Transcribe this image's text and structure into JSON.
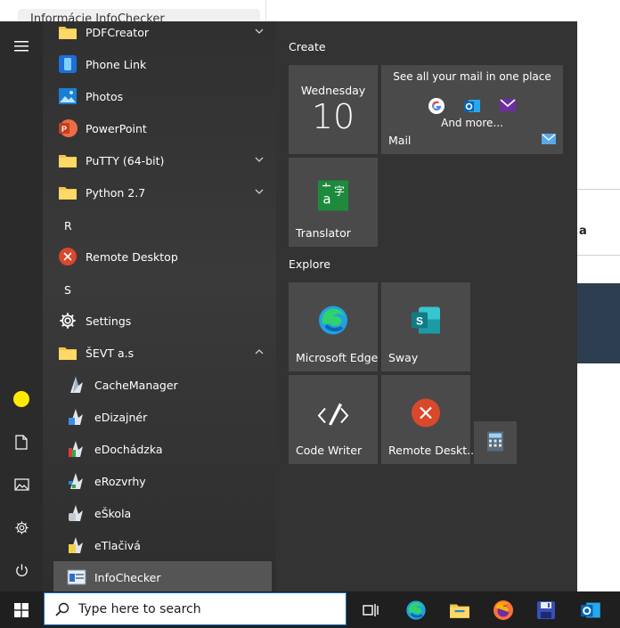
{
  "background": {
    "top_text": "Informácie InfoChecker",
    "letter_fragment": "a"
  },
  "app_list": {
    "items": [
      {
        "label": "PDFCreator",
        "icon": "folder-icon",
        "expandable": true
      },
      {
        "label": "Phone Link",
        "icon": "phone-link-icon"
      },
      {
        "label": "Photos",
        "icon": "photos-icon"
      },
      {
        "label": "PowerPoint",
        "icon": "powerpoint-icon"
      },
      {
        "label": "PuTTY (64-bit)",
        "icon": "folder-icon",
        "expandable": true
      },
      {
        "label": "Python 2.7",
        "icon": "folder-icon",
        "expandable": true
      },
      {
        "header": "R"
      },
      {
        "label": "Remote Desktop",
        "icon": "remote-desktop-icon"
      },
      {
        "header": "S"
      },
      {
        "label": "Settings",
        "icon": "gear-icon"
      },
      {
        "label": "ŠEVT a.s",
        "icon": "folder-icon",
        "expanded": true
      },
      {
        "label": "CacheManager",
        "icon": "cachemanager-icon",
        "sub": true
      },
      {
        "label": "eDizajnér",
        "icon": "edizajner-icon",
        "sub": true
      },
      {
        "label": "eDochádzka",
        "icon": "edochadzka-icon",
        "sub": true
      },
      {
        "label": "eRozvrhy",
        "icon": "erozvrhy-icon",
        "sub": true
      },
      {
        "label": "eŠkola",
        "icon": "eskola-icon",
        "sub": true
      },
      {
        "label": "eTlačivá",
        "icon": "etlaciva-icon",
        "sub": true
      },
      {
        "label": "InfoChecker",
        "icon": "infochecker-icon",
        "sub": true,
        "highlighted": true
      }
    ]
  },
  "groups": {
    "create": "Create",
    "explore": "Explore"
  },
  "tiles": {
    "calendar": {
      "day": "Wednesday",
      "date": "10"
    },
    "mail": {
      "promo": "See all your mail in one place",
      "more": "And more...",
      "label": "Mail"
    },
    "translator": {
      "label": "Translator"
    },
    "edge": {
      "label": "Microsoft Edge"
    },
    "sway": {
      "label": "Sway"
    },
    "codewriter": {
      "label": "Code Writer"
    },
    "remote": {
      "label": "Remote Deskt..."
    }
  },
  "taskbar": {
    "search_placeholder": "Type here to search"
  },
  "colors": {
    "accent": "#0f6cbd",
    "avatar": "#ffea00",
    "tile": "#4a4a4a"
  }
}
